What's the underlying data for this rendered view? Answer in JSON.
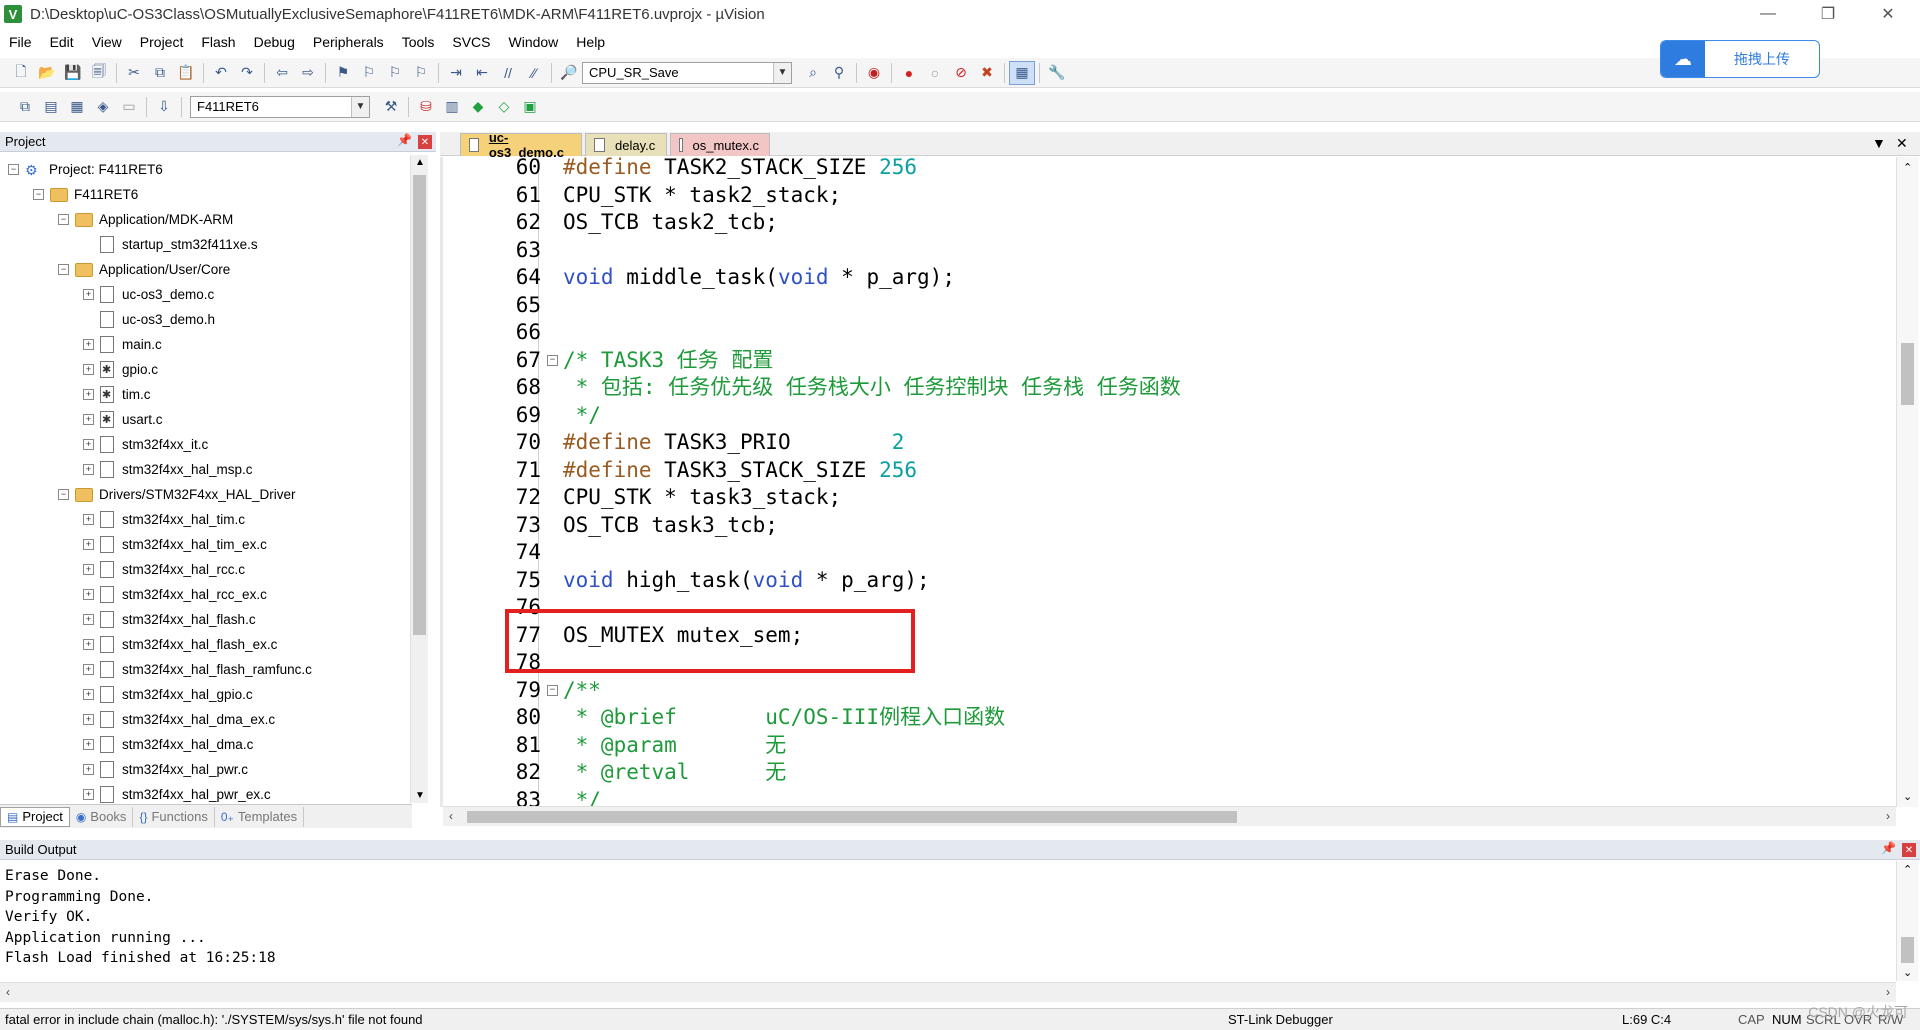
{
  "window": {
    "title": "D:\\Desktop\\uC-OS3Class\\OSMutuallyExclusiveSemaphore\\F411RET6\\MDK-ARM\\F411RET6.uvprojx - µVision"
  },
  "menu": [
    "File",
    "Edit",
    "View",
    "Project",
    "Flash",
    "Debug",
    "Peripherals",
    "Tools",
    "SVCS",
    "Window",
    "Help"
  ],
  "toolbar": {
    "search_combo": "CPU_SR_Save",
    "target_combo": "F411RET6"
  },
  "upload_button": {
    "label": "拖拽上传"
  },
  "project_panel": {
    "title": "Project",
    "tree": [
      {
        "label": "Project: F411RET6",
        "type": "project",
        "level": 0,
        "toggle": "−"
      },
      {
        "label": "F411RET6",
        "type": "folder",
        "level": 1,
        "toggle": "−"
      },
      {
        "label": "Application/MDK-ARM",
        "type": "folder",
        "level": 2,
        "toggle": "−"
      },
      {
        "label": "startup_stm32f411xe.s",
        "type": "file",
        "level": 3,
        "toggle": ""
      },
      {
        "label": "Application/User/Core",
        "type": "folder",
        "level": 2,
        "toggle": "−"
      },
      {
        "label": "uc-os3_demo.c",
        "type": "file",
        "level": 3,
        "toggle": "+"
      },
      {
        "label": "uc-os3_demo.h",
        "type": "file",
        "level": 3,
        "toggle": ""
      },
      {
        "label": "main.c",
        "type": "file",
        "level": 3,
        "toggle": "+"
      },
      {
        "label": "gpio.c",
        "type": "gear",
        "level": 3,
        "toggle": "+"
      },
      {
        "label": "tim.c",
        "type": "gear",
        "level": 3,
        "toggle": "+"
      },
      {
        "label": "usart.c",
        "type": "gear",
        "level": 3,
        "toggle": "+"
      },
      {
        "label": "stm32f4xx_it.c",
        "type": "file",
        "level": 3,
        "toggle": "+"
      },
      {
        "label": "stm32f4xx_hal_msp.c",
        "type": "file",
        "level": 3,
        "toggle": "+"
      },
      {
        "label": "Drivers/STM32F4xx_HAL_Driver",
        "type": "folder",
        "level": 2,
        "toggle": "−"
      },
      {
        "label": "stm32f4xx_hal_tim.c",
        "type": "file",
        "level": 3,
        "toggle": "+"
      },
      {
        "label": "stm32f4xx_hal_tim_ex.c",
        "type": "file",
        "level": 3,
        "toggle": "+"
      },
      {
        "label": "stm32f4xx_hal_rcc.c",
        "type": "file",
        "level": 3,
        "toggle": "+"
      },
      {
        "label": "stm32f4xx_hal_rcc_ex.c",
        "type": "file",
        "level": 3,
        "toggle": "+"
      },
      {
        "label": "stm32f4xx_hal_flash.c",
        "type": "file",
        "level": 3,
        "toggle": "+"
      },
      {
        "label": "stm32f4xx_hal_flash_ex.c",
        "type": "file",
        "level": 3,
        "toggle": "+"
      },
      {
        "label": "stm32f4xx_hal_flash_ramfunc.c",
        "type": "file",
        "level": 3,
        "toggle": "+"
      },
      {
        "label": "stm32f4xx_hal_gpio.c",
        "type": "file",
        "level": 3,
        "toggle": "+"
      },
      {
        "label": "stm32f4xx_hal_dma_ex.c",
        "type": "file",
        "level": 3,
        "toggle": "+"
      },
      {
        "label": "stm32f4xx_hal_dma.c",
        "type": "file",
        "level": 3,
        "toggle": "+"
      },
      {
        "label": "stm32f4xx_hal_pwr.c",
        "type": "file",
        "level": 3,
        "toggle": "+"
      },
      {
        "label": "stm32f4xx_hal_pwr_ex.c",
        "type": "file",
        "level": 3,
        "toggle": "+"
      }
    ],
    "bottom_tabs": [
      {
        "label": "Project",
        "icon": "project-icon",
        "active": true
      },
      {
        "label": "Books",
        "icon": "books-icon",
        "active": false
      },
      {
        "label": "Functions",
        "icon": "functions-icon",
        "active": false
      },
      {
        "label": "Templates",
        "icon": "templates-icon",
        "active": false
      }
    ]
  },
  "editor": {
    "tabs": [
      {
        "label": "uc-os3_demo.c",
        "active": true,
        "color": "#f5d27a"
      },
      {
        "label": "delay.c",
        "active": false,
        "color": "#e8e0b8"
      },
      {
        "label": "os_mutex.c",
        "active": false,
        "color": "#f3c6c6"
      }
    ],
    "lines": [
      {
        "n": "60",
        "html": "<span class=\"pp\">#define</span> TASK2_STACK_SIZE <span class=\"num\">256</span>",
        "fold": ""
      },
      {
        "n": "61",
        "html": "CPU_STK * task2_stack;",
        "fold": ""
      },
      {
        "n": "62",
        "html": "OS_TCB task2_tcb;",
        "fold": ""
      },
      {
        "n": "63",
        "html": "",
        "fold": ""
      },
      {
        "n": "64",
        "html": "<span class=\"kw\">void</span> middle_task(<span class=\"kw\">void</span> * p_arg);",
        "fold": ""
      },
      {
        "n": "65",
        "html": "",
        "fold": ""
      },
      {
        "n": "66",
        "html": "",
        "fold": ""
      },
      {
        "n": "67",
        "html": "<span class=\"cm\">/* TASK3 任务 配置</span>",
        "fold": "−"
      },
      {
        "n": "68",
        "html": "<span class=\"cm\"> * 包括: 任务优先级 任务栈大小 任务控制块 任务栈 任务函数</span>",
        "fold": ""
      },
      {
        "n": "69",
        "html": "<span class=\"cm\"> */</span>",
        "fold": ""
      },
      {
        "n": "70",
        "html": "<span class=\"pp\">#define</span> TASK3_PRIO        <span class=\"num\">2</span>",
        "fold": ""
      },
      {
        "n": "71",
        "html": "<span class=\"pp\">#define</span> TASK3_STACK_SIZE <span class=\"num\">256</span>",
        "fold": ""
      },
      {
        "n": "72",
        "html": "CPU_STK * task3_stack;",
        "fold": ""
      },
      {
        "n": "73",
        "html": "OS_TCB task3_tcb;",
        "fold": ""
      },
      {
        "n": "74",
        "html": "",
        "fold": ""
      },
      {
        "n": "75",
        "html": "<span class=\"kw\">void</span> high_task(<span class=\"kw\">void</span> * p_arg);",
        "fold": ""
      },
      {
        "n": "76",
        "html": "",
        "fold": ""
      },
      {
        "n": "77",
        "html": "OS_MUTEX mutex_sem;",
        "fold": ""
      },
      {
        "n": "78",
        "html": "",
        "fold": ""
      },
      {
        "n": "79",
        "html": "<span class=\"cm\">/**</span>",
        "fold": "−"
      },
      {
        "n": "80",
        "html": "<span class=\"cm\"> * @brief       uC/OS-III例程入口函数</span>",
        "fold": ""
      },
      {
        "n": "81",
        "html": "<span class=\"cm\"> * @param       无</span>",
        "fold": ""
      },
      {
        "n": "82",
        "html": "<span class=\"cm\"> * @retval      无</span>",
        "fold": ""
      },
      {
        "n": "83",
        "html": "<span class=\"cm\"> */</span>",
        "fold": ""
      }
    ]
  },
  "build_output": {
    "title": "Build Output",
    "text": "Erase Done.\nProgramming Done.\nVerify OK.\nApplication running ...\nFlash Load finished at 16:25:18"
  },
  "status": {
    "message": "fatal error in include chain (malloc.h): './SYSTEM/sys/sys.h' file not found",
    "debugger": "ST-Link Debugger",
    "position": "L:69 C:4",
    "caps": "CAP",
    "num": "NUM",
    "scrl": "SCRL",
    "ovr": "OVR",
    "rw": "R/W"
  },
  "watermark": "CSDN @火龙可"
}
